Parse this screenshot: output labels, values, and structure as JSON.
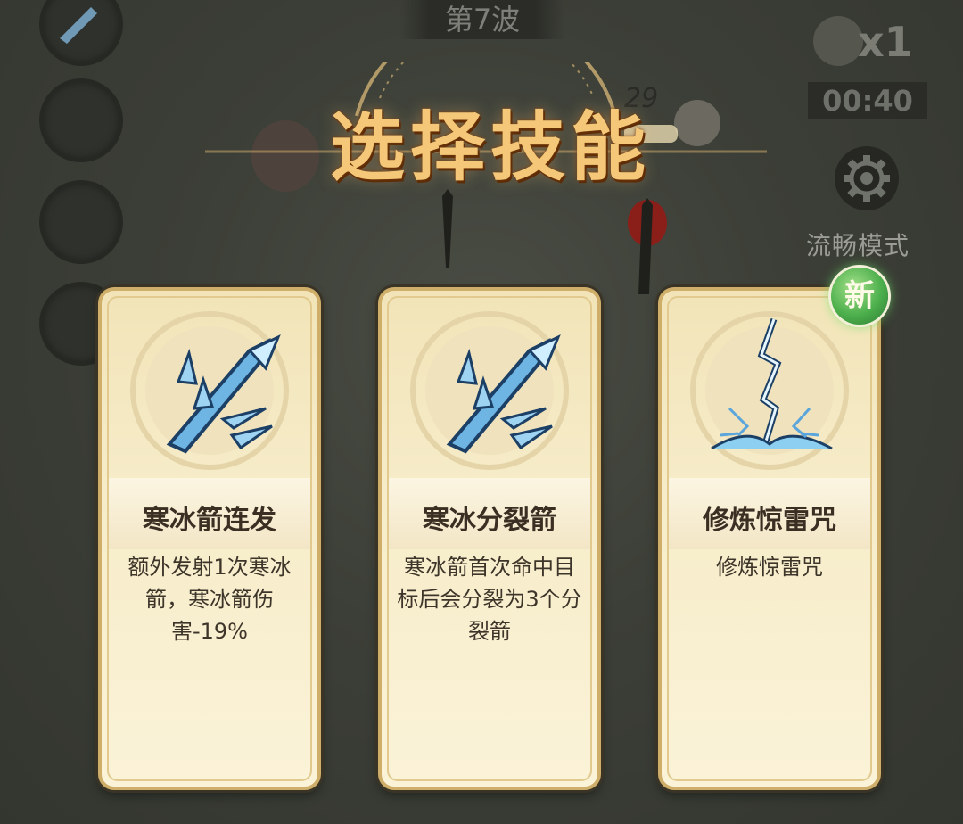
{
  "hud": {
    "wave_label": "第7波",
    "speed_label": "x1",
    "timer": "00:40",
    "smooth_mode_label": "流畅模式",
    "new_badge": "新",
    "float_number": "29"
  },
  "dialog": {
    "title": "选择技能"
  },
  "cards": [
    {
      "name": "寒冰箭连发",
      "desc": "额外发射1次寒冰箭，寒冰箭伤害-19%",
      "icon": "ice-arrow-icon"
    },
    {
      "name": "寒冰分裂箭",
      "desc": "寒冰箭首次命中目标后会分裂为3个分裂箭",
      "icon": "ice-arrow-icon"
    },
    {
      "name": "修炼惊雷咒",
      "desc": "修炼惊雷咒",
      "icon": "lightning-icon"
    }
  ],
  "colors": {
    "title": "#f4c878",
    "card_bg": "#f6ecc9",
    "card_border": "#cfae6a",
    "new_badge": "#4caf4c"
  }
}
